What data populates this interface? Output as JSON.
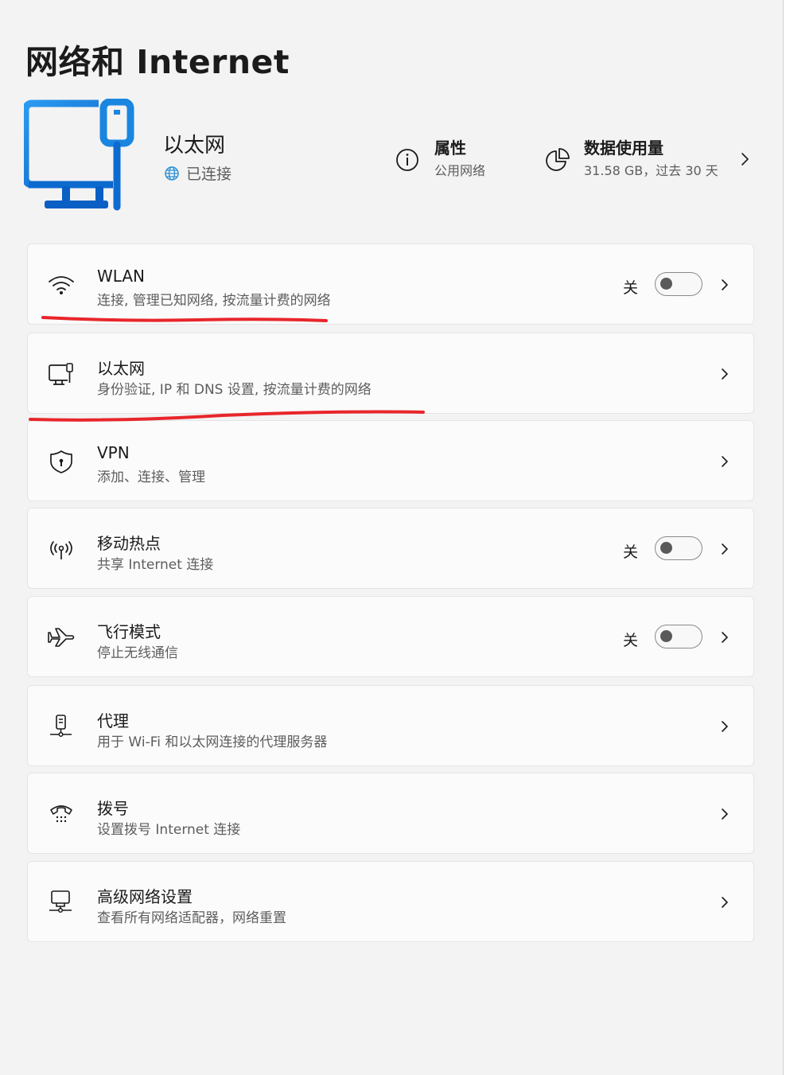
{
  "page": {
    "title": "网络和 Internet"
  },
  "hero": {
    "name": "以太网",
    "status": "已连接",
    "icon": "ethernet-monitor-icon",
    "properties": {
      "title": "属性",
      "subtitle": "公用网络",
      "icon": "info-icon"
    },
    "data_usage": {
      "title": "数据使用量",
      "subtitle": "31.58 GB，过去 30 天",
      "icon": "pie-chart-icon"
    }
  },
  "items": [
    {
      "title": "WLAN",
      "subtitle": "连接, 管理已知网络, 按流量计费的网络",
      "icon": "wifi-icon",
      "toggle": true,
      "state": "关"
    },
    {
      "title": "以太网",
      "subtitle": "身份验证, IP 和 DNS 设置, 按流量计费的网络",
      "icon": "ethernet-icon",
      "toggle": false
    },
    {
      "title": "VPN",
      "subtitle": "添加、连接、管理",
      "icon": "shield-icon",
      "toggle": false
    },
    {
      "title": "移动热点",
      "subtitle": "共享 Internet 连接",
      "icon": "hotspot-icon",
      "toggle": true,
      "state": "关"
    },
    {
      "title": "飞行模式",
      "subtitle": "停止无线通信",
      "icon": "airplane-icon",
      "toggle": true,
      "state": "关"
    },
    {
      "title": "代理",
      "subtitle": "用于 Wi-Fi 和以太网连接的代理服务器",
      "icon": "proxy-icon",
      "toggle": false
    },
    {
      "title": "拨号",
      "subtitle": "设置拨号 Internet 连接",
      "icon": "dialup-icon",
      "toggle": false
    },
    {
      "title": "高级网络设置",
      "subtitle": "查看所有网络适配器，网络重置",
      "icon": "advanced-network-icon",
      "toggle": false
    }
  ],
  "colors": {
    "accent": "#0067c0",
    "annotation": "#e8262b"
  }
}
